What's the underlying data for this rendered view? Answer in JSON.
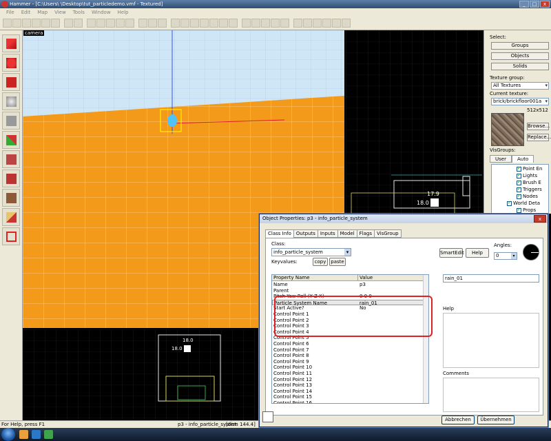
{
  "window": {
    "title": "Hammer - [C:\\Users\\            \\Desktop\\tut_particledemo.vmf - Textured]",
    "controls": [
      "_",
      "□",
      "x"
    ]
  },
  "menu": [
    "File",
    "Edit",
    "Map",
    "View",
    "Tools",
    "Window",
    "Help"
  ],
  "viewport3d": {
    "label": "camera"
  },
  "viewport2d": {
    "label_a": "17.9",
    "label_b": "18.0",
    "label_c": "18.0",
    "label_d": "18.0"
  },
  "right_panel": {
    "select_label": "Select:",
    "buttons": [
      "Groups",
      "Objects",
      "Solids"
    ],
    "texture_group_label": "Texture group:",
    "texture_group_value": "All Textures",
    "current_texture_label": "Current texture:",
    "current_texture_value": "brick/brickfloor001a",
    "texture_size": "512x512",
    "browse_label": "Browse...",
    "replace_label": "Replace...",
    "visgroups_label": "VisGroups:",
    "tabs": [
      "User",
      "Auto"
    ],
    "visgroups": [
      "Point En",
      "Lights",
      "Brush E",
      "Triggers",
      "Nodes",
      "World Deta",
      "Props"
    ]
  },
  "status": {
    "help": "For Help, press F1",
    "selection": "p3 - info_particle_system",
    "dist": "[dist: 144.4]"
  },
  "dialog": {
    "title": "Object Properties: p3 - info_particle_system",
    "tabs": [
      "Class Info",
      "Outputs",
      "Inputs",
      "Model",
      "Flags",
      "VisGroup"
    ],
    "class_label": "Class:",
    "class_value": "info_particle_system",
    "keyvalues_label": "Keyvalues:",
    "copy_label": "copy",
    "paste_label": "paste",
    "smartedit_label": "SmartEdit",
    "help_button_label": "Help",
    "angles_label": "Angles:",
    "angles_value": "0",
    "col_property": "Property Name",
    "col_value": "Value",
    "rows": [
      {
        "k": "Name",
        "v": "p3"
      },
      {
        "k": "Parent",
        "v": ""
      },
      {
        "k": "Pitch Yaw Roll (Y Z X)",
        "v": "0 0 0"
      },
      {
        "k": "Particle System Name",
        "v": "rain_01"
      },
      {
        "k": "Start Active?",
        "v": "No"
      },
      {
        "k": "Control Point 1",
        "v": ""
      },
      {
        "k": "Control Point 2",
        "v": ""
      },
      {
        "k": "Control Point 3",
        "v": ""
      },
      {
        "k": "Control Point 4",
        "v": ""
      },
      {
        "k": "Control Point 5",
        "v": ""
      },
      {
        "k": "Control Point 6",
        "v": ""
      },
      {
        "k": "Control Point 7",
        "v": ""
      },
      {
        "k": "Control Point 8",
        "v": ""
      },
      {
        "k": "Control Point 9",
        "v": ""
      },
      {
        "k": "Control Point 10",
        "v": ""
      },
      {
        "k": "Control Point 11",
        "v": ""
      },
      {
        "k": "Control Point 12",
        "v": ""
      },
      {
        "k": "Control Point 13",
        "v": ""
      },
      {
        "k": "Control Point 14",
        "v": ""
      },
      {
        "k": "Control Point 15",
        "v": ""
      },
      {
        "k": "Control Point 16",
        "v": ""
      }
    ],
    "value_input": "rain_01",
    "help_group_label": "Help",
    "comments_label": "Comments",
    "abbrechen_label": "Abbrechen",
    "uebernehmen_label": "Übernehmen",
    "close_label": "x"
  }
}
